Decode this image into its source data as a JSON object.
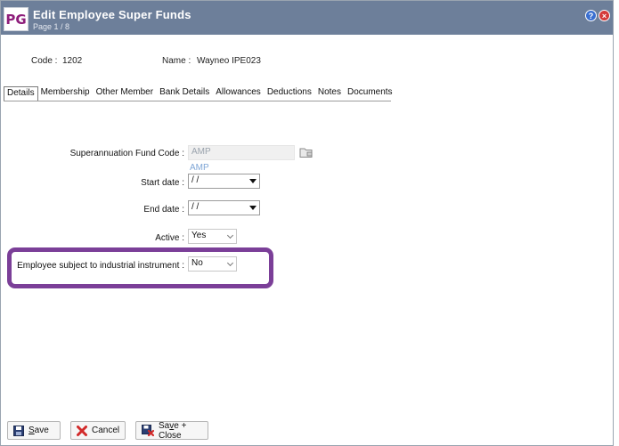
{
  "window": {
    "logo_text": "PG",
    "title": "Edit Employee Super Funds",
    "subtitle": "Page 1 / 8",
    "help_icon": "help-icon",
    "close_icon": "close-icon"
  },
  "header": {
    "code_label": "Code :",
    "code_value": "1202",
    "name_label": "Name :",
    "name_value": "Wayneo IPE023"
  },
  "tabs": [
    {
      "label": "Details",
      "active": true
    },
    {
      "label": "Membership"
    },
    {
      "label": "Other Member"
    },
    {
      "label": "Bank Details"
    },
    {
      "label": "Allowances"
    },
    {
      "label": "Deductions"
    },
    {
      "label": "Notes"
    },
    {
      "label": "Documents"
    }
  ],
  "form": {
    "fund_code_label": "Superannuation Fund Code :",
    "fund_code_value": "AMP",
    "fund_description": "AMP",
    "start_date_label": "Start date :",
    "start_date_value": "/ /",
    "end_date_label": "End date :",
    "end_date_value": "/ /",
    "active_label": "Active :",
    "active_value": "Yes",
    "industrial_label": "Employee subject to industrial instrument :",
    "industrial_value": "No"
  },
  "buttons": {
    "save_first": "S",
    "save_rest": "ave",
    "cancel": "Cancel",
    "save_close_pre": "Sa",
    "save_close_under": "v",
    "save_close_post": "e + Close"
  },
  "colors": {
    "titlebar": "#6d7f9a",
    "highlight": "#7b3f98",
    "brand": "#8e1e7b"
  }
}
